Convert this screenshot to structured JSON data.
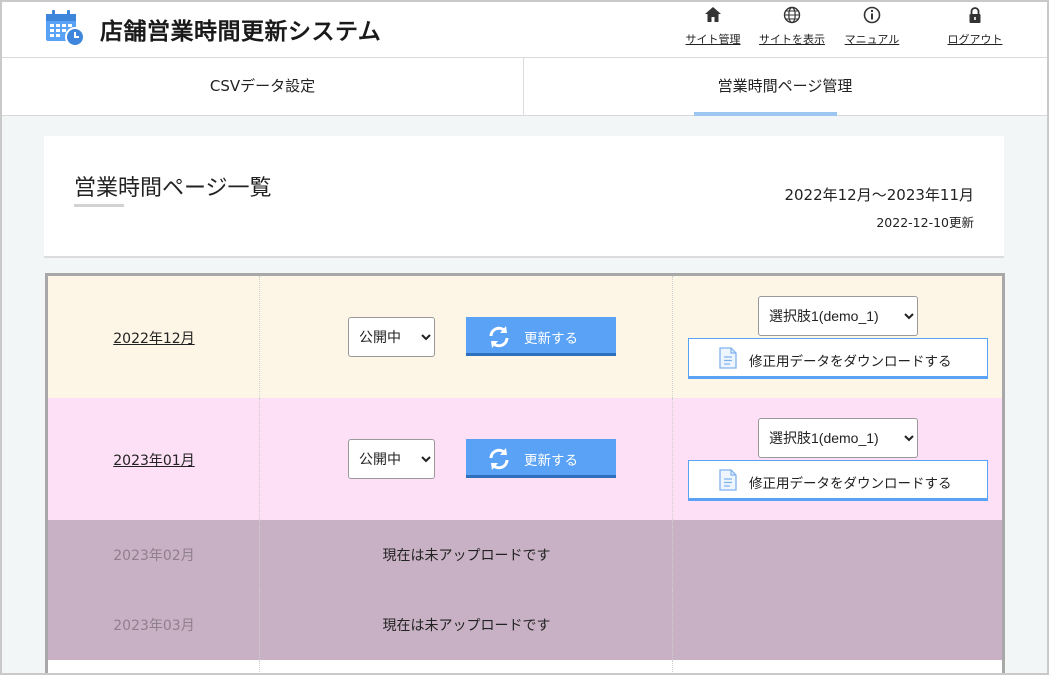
{
  "header": {
    "title": "店舗営業時間更新システム",
    "nav": [
      {
        "label": "サイト管理",
        "icon": "home-icon"
      },
      {
        "label": "サイトを表示",
        "icon": "globe-icon"
      },
      {
        "label": "マニュアル",
        "icon": "info-icon"
      },
      {
        "label": "ログアウト",
        "icon": "lock-icon"
      }
    ]
  },
  "tabs": [
    {
      "label": "CSVデータ設定",
      "active": false
    },
    {
      "label": "営業時間ページ管理",
      "active": true
    }
  ],
  "page": {
    "title": "営業時間ページ一覧",
    "range": "2022年12月～2023年11月",
    "updated": "2022-12-10更新"
  },
  "rows": [
    {
      "month": "2022年12月",
      "status": "公開中",
      "update_label": "更新する",
      "choice": "選択肢1(demo_1)",
      "download_label": "修正用データをダウンロードする",
      "bg": "#fdf5e6"
    },
    {
      "month": "2023年01月",
      "status": "公開中",
      "update_label": "更新する",
      "choice": "選択肢1(demo_1)",
      "download_label": "修正用データをダウンロードする",
      "bg": "#fde0f6"
    },
    {
      "month": "2023年02月",
      "message": "現在は未アップロードです",
      "bg": "#c8b1c4"
    },
    {
      "month": "2023年03月",
      "message": "現在は未アップロードです",
      "bg": "#c8b1c4"
    }
  ],
  "colors": {
    "accent": "#5aa2f5",
    "tab_underline": "#9dc6f0"
  }
}
